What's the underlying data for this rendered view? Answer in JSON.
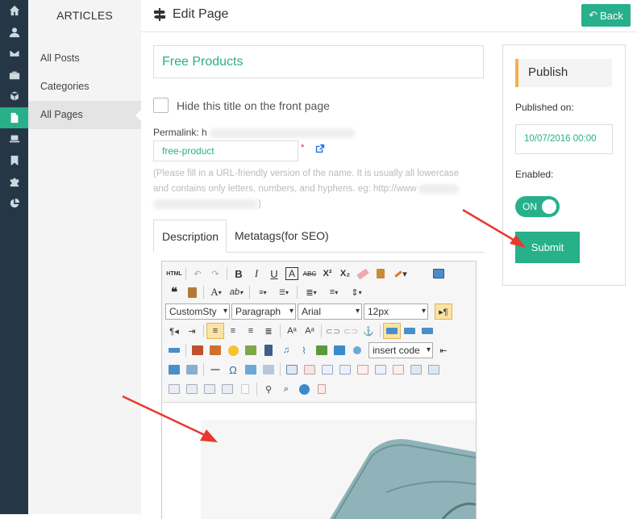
{
  "nav": {
    "section_title": "ARTICLES",
    "items": [
      {
        "label": "All Posts"
      },
      {
        "label": "Categories"
      },
      {
        "label": "All Pages"
      }
    ],
    "rail_icons": [
      "home-icon",
      "user-icon",
      "mail-icon",
      "briefcase-icon",
      "cube-icon",
      "page-icon",
      "laptop-icon",
      "bookmark-icon",
      "puzzle-icon",
      "pie-chart-icon"
    ],
    "rail_active_icon": "page-icon"
  },
  "header": {
    "title": "Edit Page",
    "back_label": "Back"
  },
  "form": {
    "title_value": "Free Products",
    "hide_title_label": "Hide this title on the front page",
    "hide_title_checked": false,
    "permalink_label": "Permalink: h",
    "slug_value": "free-product",
    "required_mark": "*",
    "hint_line1": "(Please fill in a URL-friendly version of the name. It is usually all lowercase",
    "hint_line2": "and contains only letters, numbers, and hyphens. eg: http://www",
    "hint_line3": ")"
  },
  "tabs": [
    {
      "label": "Description",
      "active": true
    },
    {
      "label": "Metatags(for SEO)",
      "active": false
    }
  ],
  "editor": {
    "style_select": "CustomSty",
    "format_select": "Paragraph",
    "font_select": "Arial",
    "size_select": "12px",
    "insert_code_select": "insert code",
    "html_button_label": "HTML",
    "font_color_label": "A",
    "bold_label": "B",
    "italic_label": "I",
    "underline_label": "U",
    "strike_label": "ABC",
    "superscript_label": "X²",
    "subscript_label": "X₂",
    "quote_label": "❝",
    "hr_label": "—",
    "omega_label": "Ω",
    "font_a_label": "A",
    "highlight_label": "ab"
  },
  "publish": {
    "heading": "Publish",
    "published_on_label": "Published on:",
    "published_on_value": "10/07/2016 00:00",
    "enabled_label": "Enabled:",
    "toggle_label": "ON",
    "enabled": true,
    "submit_label": "Submit"
  },
  "colors": {
    "accent": "#27b08a",
    "rail": "#253746",
    "arrow": "#e8392f",
    "marker": "#f4b04a"
  }
}
